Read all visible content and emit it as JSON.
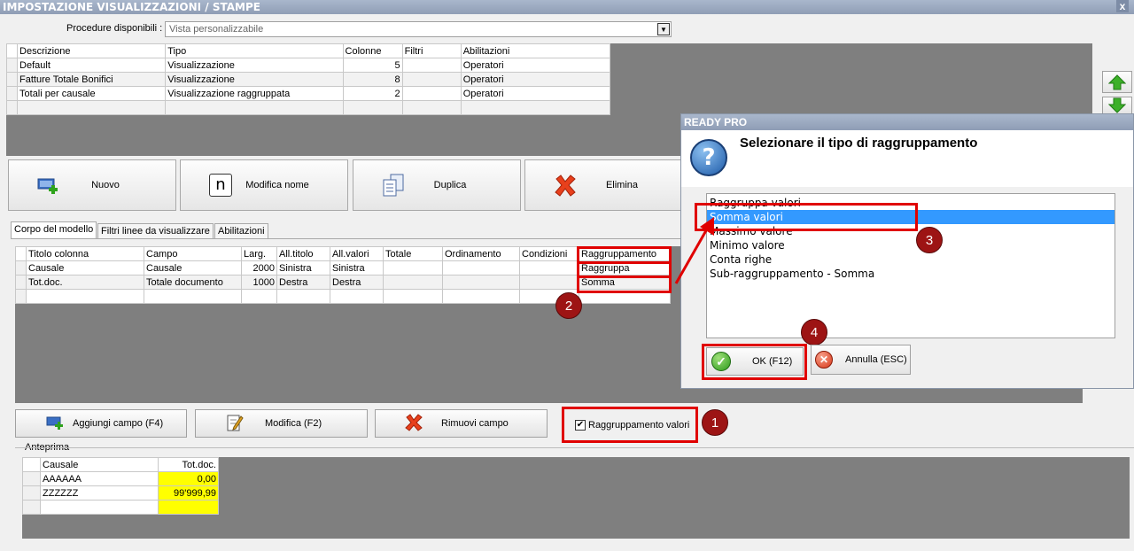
{
  "window": {
    "title": "IMPOSTAZIONE VISUALIZZAZIONI / STAMPE",
    "close": "x"
  },
  "procedure": {
    "label": "Procedure disponibili :",
    "value": "Vista personalizzabile"
  },
  "views_table": {
    "headers": [
      "Descrizione",
      "Tipo",
      "Colonne",
      "Filtri",
      "Abilitazioni"
    ],
    "rows": [
      {
        "desc": "Default",
        "tipo": "Visualizzazione",
        "colonne": "5",
        "filtri": "",
        "abil": "Operatori"
      },
      {
        "desc": "Fatture Totale Bonifici",
        "tipo": "Visualizzazione",
        "colonne": "8",
        "filtri": "",
        "abil": "Operatori"
      },
      {
        "desc": "Totali per causale",
        "tipo": "Visualizzazione raggruppata",
        "colonne": "2",
        "filtri": "",
        "abil": "Operatori"
      }
    ]
  },
  "toolbar": {
    "nuovo": "Nuovo",
    "modifica_nome": "Modifica nome",
    "duplica": "Duplica",
    "elimina": "Elimina",
    "n_letter": "n"
  },
  "tabs": [
    "Corpo del modello",
    "Filtri linee da visualizzare",
    "Abilitazioni"
  ],
  "fields_table": {
    "headers": [
      "Titolo colonna",
      "Campo",
      "Larg.",
      "All.titolo",
      "All.valori",
      "Totale",
      "Ordinamento",
      "Condizioni",
      "Raggruppamento"
    ],
    "rows": [
      {
        "titolo": "Causale",
        "campo": "Causale",
        "larg": "2000",
        "alltit": "Sinistra",
        "allval": "Sinistra",
        "totale": "",
        "ord": "",
        "cond": "",
        "ragg": "Raggruppa"
      },
      {
        "titolo": "Tot.doc.",
        "campo": "Totale documento",
        "larg": "1000",
        "alltit": "Destra",
        "allval": "Destra",
        "totale": "",
        "ord": "",
        "cond": "",
        "ragg": "Somma"
      }
    ]
  },
  "bottom_buttons": {
    "aggiungi": "Aggiungi campo (F4)",
    "modifica": "Modifica (F2)",
    "rimuovi": "Rimuovi campo"
  },
  "checkbox": {
    "label": "Raggruppamento valori",
    "checked": true
  },
  "preview": {
    "label": "Anteprima",
    "headers": [
      "Causale",
      "Tot.doc."
    ],
    "rows": [
      {
        "causale": "AAAAAA",
        "tot": "0,00"
      },
      {
        "causale": "ZZZZZZ",
        "tot": "99'999,99"
      }
    ]
  },
  "dialog": {
    "title": "READY PRO",
    "heading": "Selezionare il tipo di raggruppamento",
    "options": [
      "Raggruppa valori",
      "Somma valori",
      "Massimo valore",
      "Minimo valore",
      "Conta righe",
      "Sub-raggruppamento - Somma"
    ],
    "selected": "Somma valori",
    "ok": "OK (F12)",
    "cancel": "Annulla (ESC)"
  },
  "markers": [
    "1",
    "2",
    "3",
    "4"
  ],
  "colors": {
    "accent_red": "#e00000",
    "selection": "#3399ff",
    "marker": "#9d1414",
    "highlight": "#ffff00"
  }
}
